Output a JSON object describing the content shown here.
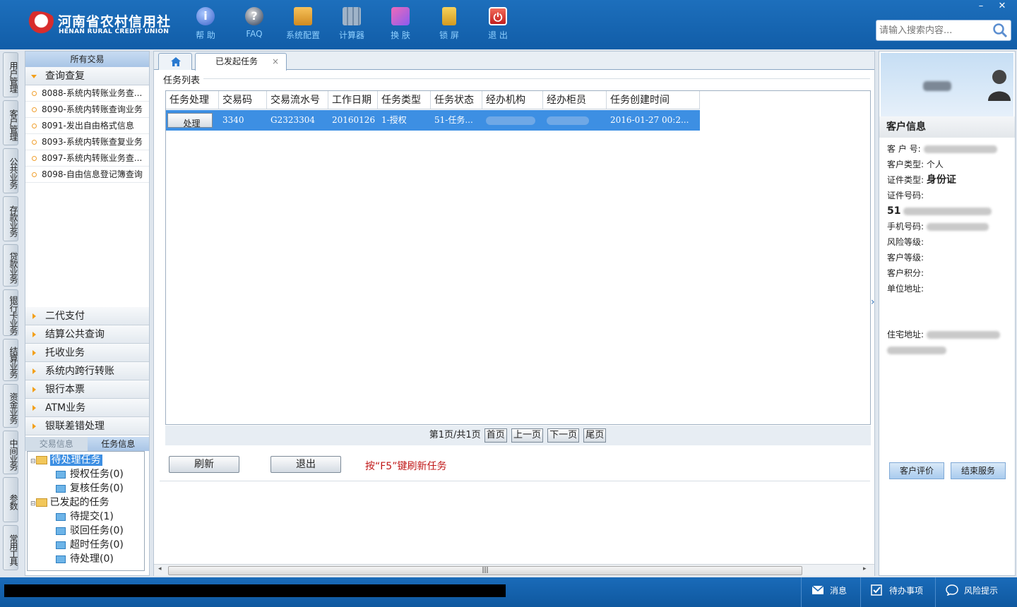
{
  "header": {
    "logo_cn": "河南省农村信用社",
    "logo_en": "HENAN RURAL CREDIT UNION",
    "tools": [
      {
        "label": "帮 助",
        "icon": "info-icon"
      },
      {
        "label": "FAQ",
        "icon": "question-icon"
      },
      {
        "label": "系统配置",
        "icon": "toolbox-icon"
      },
      {
        "label": "计算器",
        "icon": "calculator-icon"
      },
      {
        "label": "换 肤",
        "icon": "shirt-icon"
      },
      {
        "label": "锁 屏",
        "icon": "lock-icon"
      },
      {
        "label": "退 出",
        "icon": "power-icon"
      }
    ],
    "search_placeholder": "请输入搜索内容...",
    "win_min": "–",
    "win_close": "✕"
  },
  "left_tabs": [
    "用户管理",
    "客户管理",
    "公共业务",
    "存款业务",
    "贷款业务",
    "银行卡业务",
    "结算业务",
    "资金业务",
    "中间业务",
    "参数",
    "常用工具"
  ],
  "menu": {
    "title": "所有交易",
    "open_group": "查询查复",
    "items": [
      "8088-系统内转账业务查...",
      "8090-系统内转账查询业务",
      "8091-发出自由格式信息",
      "8093-系统内转账查复业务",
      "8097-系统内转账业务查...",
      "8098-自由信息登记簿查询"
    ],
    "groups": [
      "二代支付",
      "结算公共查询",
      "托收业务",
      "系统内跨行转账",
      "银行本票",
      "ATM业务",
      "银联差错处理"
    ],
    "info_tabs": [
      "交易信息",
      "任务信息"
    ],
    "tree": {
      "pending": "待处理任务",
      "auth": "授权任务(0)",
      "review": "复核任务(0)",
      "initiated": "已发起的任务",
      "to_submit": "待提交(1)",
      "rejected": "驳回任务(0)",
      "timeout": "超时任务(0)",
      "to_process": "待处理(0)"
    }
  },
  "main": {
    "tab_label": "已发起任务",
    "tab_close": "×",
    "section_title": "任务列表",
    "columns": [
      "任务处理",
      "交易码",
      "交易流水号",
      "工作日期",
      "任务类型",
      "任务状态",
      "经办机构",
      "经办柜员",
      "任务创建时间"
    ],
    "row": {
      "action": "处理",
      "code": "3340",
      "serial": "G2323304",
      "date": "20160126",
      "type": "1-授权",
      "status": "51-任务...",
      "created": "2016-01-27 00:2..."
    },
    "pager": {
      "info": "第1页/共1页",
      "first": "首页",
      "prev": "上一页",
      "next": "下一页",
      "last": "尾页"
    },
    "refresh": "刷新",
    "exit": "退出",
    "hint": "按“F5”键刷新任务"
  },
  "customer": {
    "title": "客户信息",
    "labels": {
      "no": "客 户 号:",
      "type": "客户类型:",
      "type_value": "个人",
      "id_type": "证件类型:",
      "id_type_value": "身份证",
      "id_no": "证件号码:",
      "id_prefix": "51",
      "phone": "手机号码:",
      "risk": "风险等级:",
      "level": "客户等级:",
      "points": "客户积分:",
      "work_addr": "单位地址:",
      "home_addr": "住宅地址:"
    },
    "rate_btn": "客户评价",
    "end_btn": "结束服务"
  },
  "status": {
    "messages": "消息",
    "todo": "待办事项",
    "risk": "风险提示"
  },
  "colors": {
    "topbar": "#1a67b4",
    "selected_row": "#3d8fe3",
    "hint": "#c01818"
  }
}
